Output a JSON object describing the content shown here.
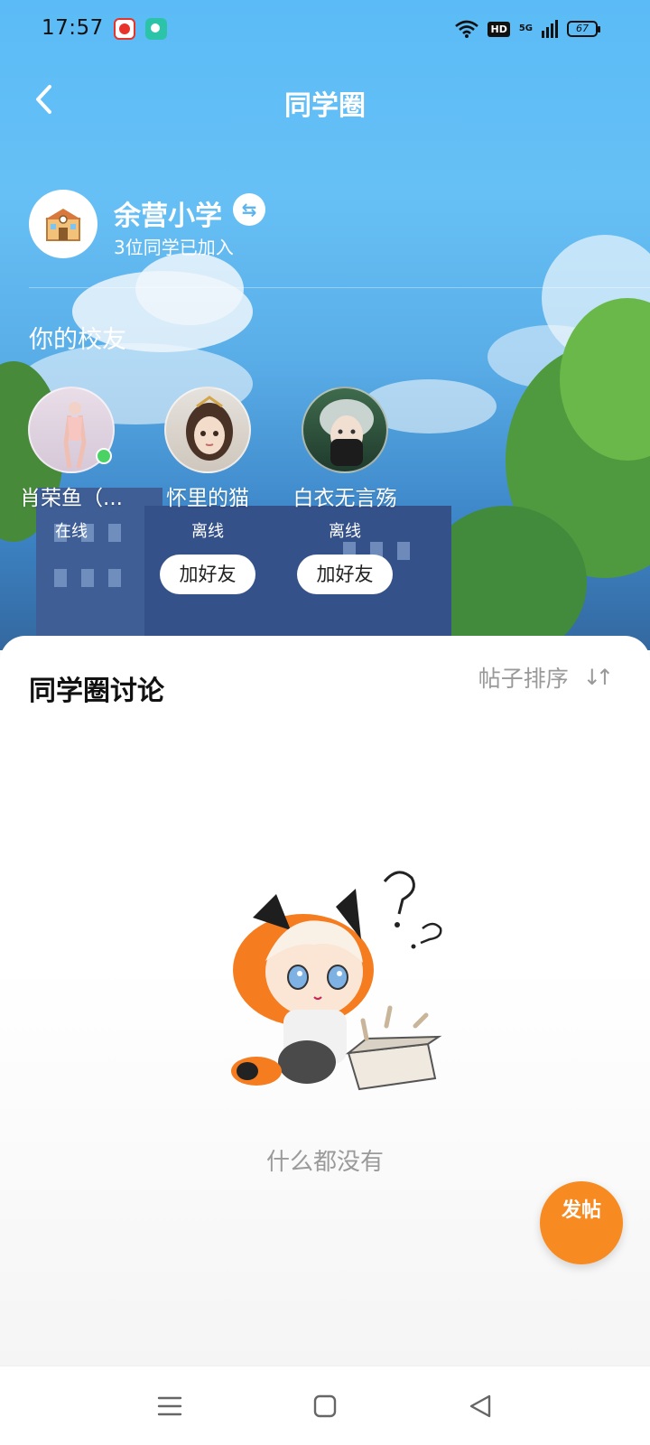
{
  "status_bar": {
    "time": "17:57",
    "badge_hd": "HD",
    "signal": "5G",
    "battery": "67"
  },
  "nav": {
    "title": "同学圈",
    "back_icon": "chevron-left-icon"
  },
  "school": {
    "name": "余营小学",
    "subtitle": "3位同学已加入",
    "avatar_icon": "school-icon",
    "switch_icon": "swap-icon"
  },
  "alumni": {
    "title": "你的校友",
    "friends": [
      {
        "name": "肖荣鱼（...",
        "status": "在线",
        "online": true
      },
      {
        "name": "怀里的猫",
        "status": "离线",
        "online": false,
        "action": "加好友"
      },
      {
        "name": "白衣无言殇",
        "status": "离线",
        "online": false,
        "action": "加好友"
      }
    ]
  },
  "discussion": {
    "title": "同学圈讨论",
    "sort_label": "帖子排序",
    "sort_icon": "sort-icon",
    "empty_text": "什么都没有"
  },
  "fab": {
    "label": "发帖"
  },
  "colors": {
    "sky_top": "#5bbbf6",
    "accent_orange": "#f78a21",
    "online_green": "#4ad364"
  }
}
